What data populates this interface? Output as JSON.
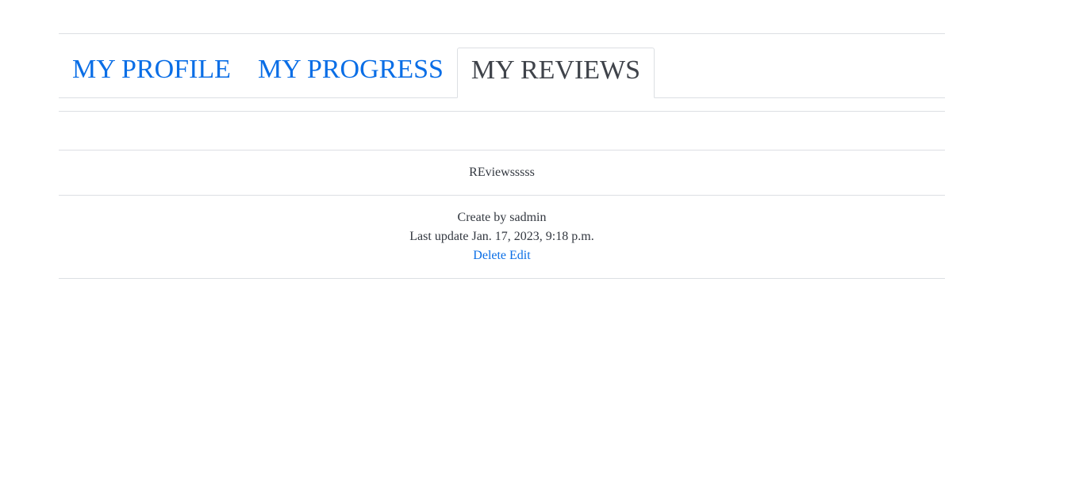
{
  "tabs": [
    {
      "label": "MY PROFILE",
      "active": false
    },
    {
      "label": "MY PROGRESS",
      "active": false
    },
    {
      "label": "MY REVIEWS",
      "active": true
    }
  ],
  "review": {
    "title": "REviewsssss",
    "created_by": "Create by sadmin",
    "last_update": "Last update Jan. 17, 2023, 9:18 p.m.",
    "delete_label": "Delete",
    "edit_label": "Edit"
  },
  "colors": {
    "link": "#0a6ee6",
    "active_tab_text": "#3f434a",
    "border": "#dcdfe3"
  }
}
